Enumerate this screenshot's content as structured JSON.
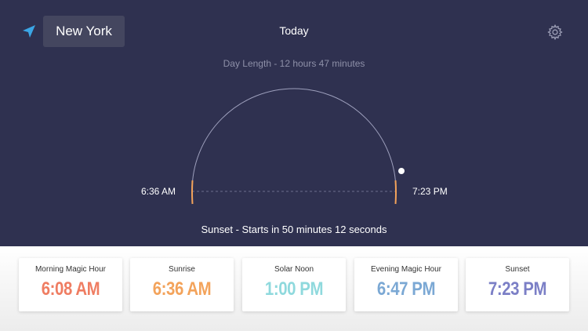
{
  "header": {
    "location_icon": "location-arrow-icon",
    "city": "New York",
    "title": "Today",
    "settings_icon": "gear-icon"
  },
  "sun": {
    "day_length": "Day Length - 12 hours 47 minutes",
    "sunrise_time": "6:36 AM",
    "sunset_time": "7:23 PM",
    "status": "Sunset - Starts in 50 minutes 12 seconds"
  },
  "cards": [
    {
      "label": "Morning Magic Hour",
      "time": "6:08 AM",
      "color": "#ef7d62"
    },
    {
      "label": "Sunrise",
      "time": "6:36 AM",
      "color": "#f3a35b"
    },
    {
      "label": "Solar Noon",
      "time": "1:00 PM",
      "color": "#8fd9dd"
    },
    {
      "label": "Evening Magic Hour",
      "time": "6:47 PM",
      "color": "#7ba8d4"
    },
    {
      "label": "Sunset",
      "time": "7:23 PM",
      "color": "#7b7fc6"
    }
  ],
  "colors": {
    "background": "#2f3150",
    "accent": "#3ba6e6",
    "horizon_marker": "#f3a35b"
  }
}
